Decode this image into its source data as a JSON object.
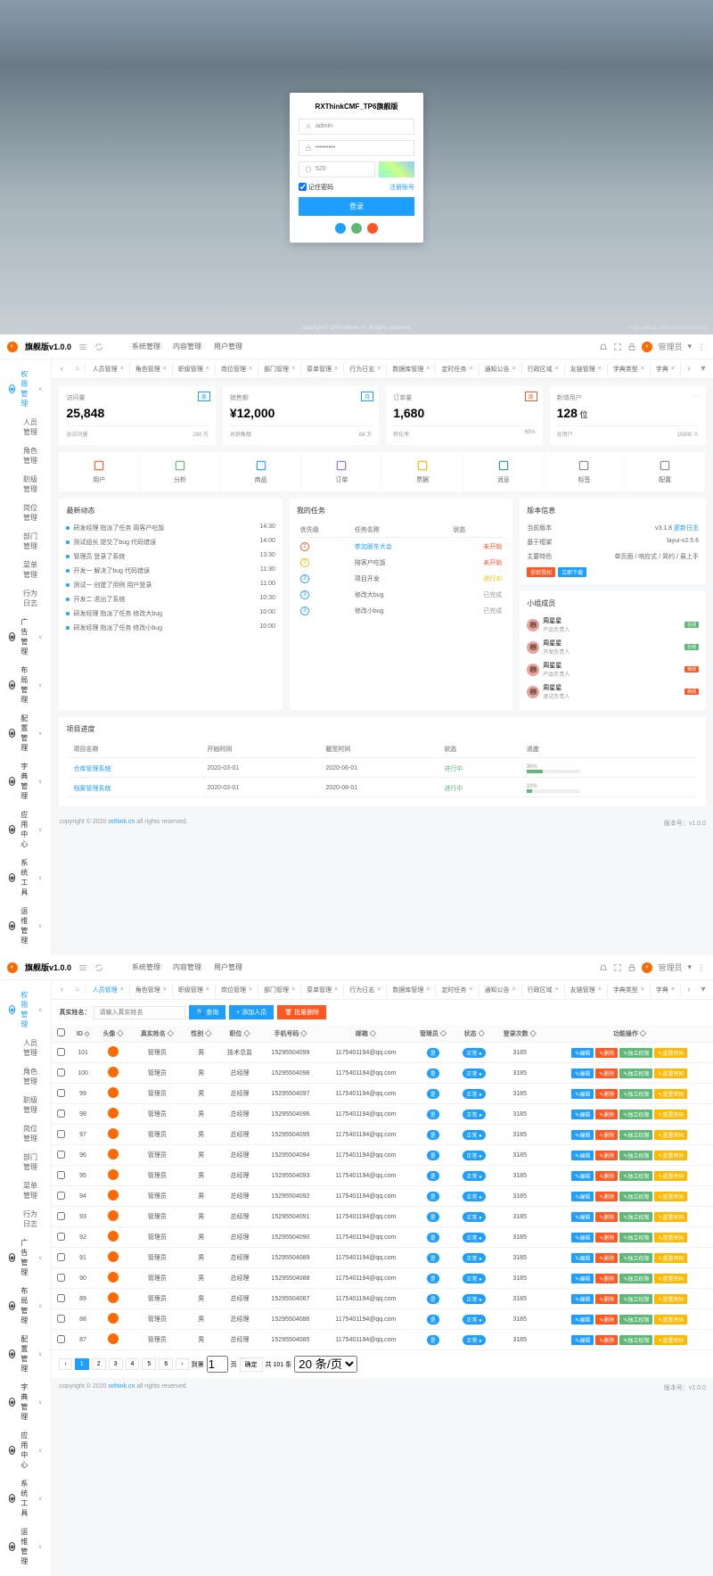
{
  "login": {
    "title": "RXThinkCMF_TP6旗舰版",
    "username": "admin",
    "password": "•••••••••",
    "captcha": "520",
    "remember": "记住密码",
    "register": "注册账号",
    "submit": "登录",
    "copyright": "copyright © 2020 rxthink.cn all rights reserved.",
    "watermark": "https://blog.csdn.net/zongzhiqing"
  },
  "topbar": {
    "title": "旗舰版v1.0.0",
    "menu": [
      "系统管理",
      "内容管理",
      "用户管理"
    ],
    "admin_label": "管理员"
  },
  "sidebar": {
    "groups": [
      {
        "icon": "◉",
        "label": "权限管理",
        "children": [
          "人员管理",
          "角色管理",
          "职级管理",
          "岗位管理",
          "部门管理",
          "菜单管理",
          "行为日志"
        ]
      },
      {
        "icon": "◉",
        "label": "广告管理"
      },
      {
        "icon": "◉",
        "label": "布局管理"
      },
      {
        "icon": "◉",
        "label": "配置管理"
      },
      {
        "icon": "◉",
        "label": "字典管理"
      },
      {
        "icon": "◉",
        "label": "应用中心"
      },
      {
        "icon": "◉",
        "label": "系统工具"
      },
      {
        "icon": "◉",
        "label": "运维管理"
      }
    ]
  },
  "tabs1": [
    "人员管理",
    "角色管理",
    "职级管理",
    "岗位管理",
    "部门管理",
    "菜单管理",
    "行为日志",
    "数据库管理",
    "定时任务",
    "通知公告",
    "行政区域",
    "友链管理",
    "字典类型",
    "字典"
  ],
  "cards": [
    {
      "title": "访问量",
      "value": "25,848",
      "foot_l": "总访问量",
      "foot_r": "280 万",
      "badge": "周",
      "badge_color": "#1E9FFF"
    },
    {
      "title": "销售额",
      "value": "¥12,000",
      "foot_l": "总销售额",
      "foot_r": "68 万",
      "badge": "月",
      "badge_color": "#1E9FFF"
    },
    {
      "title": "订单量",
      "value": "1,680",
      "foot_l": "转化率",
      "foot_r": "60%",
      "badge": "周",
      "badge_color": "#FF5722"
    },
    {
      "title": "新增用户",
      "value": "128",
      "unit": "位",
      "foot_l": "总用户",
      "foot_r": "10800 人"
    }
  ],
  "quick": [
    {
      "label": "用户",
      "color": "#FF5722"
    },
    {
      "label": "分析",
      "color": "#5FB878"
    },
    {
      "label": "商品",
      "color": "#1E9FFF"
    },
    {
      "label": "订单",
      "color": "#9370DB"
    },
    {
      "label": "票据",
      "color": "#FFB800"
    },
    {
      "label": "消息",
      "color": "#2F9688"
    },
    {
      "label": "标签",
      "color": "#888"
    },
    {
      "label": "配置",
      "color": "#888"
    }
  ],
  "news": {
    "title": "最新动态",
    "items": [
      {
        "t": "研发经理 指派了任务 周客户吃饭",
        "d": "14:30"
      },
      {
        "t": "测试组长 提交了bug 代码错误",
        "d": "14:00"
      },
      {
        "t": "管理员 登录了系统",
        "d": "13:30"
      },
      {
        "t": "开发一 解决了bug 代码错误",
        "d": "11:30"
      },
      {
        "t": "测试一 创建了用例 用户登录",
        "d": "11:00"
      },
      {
        "t": "开发二 退出了系统",
        "d": "10:30"
      },
      {
        "t": "研发经理 指派了任务 修改大bug",
        "d": "10:00"
      },
      {
        "t": "研发经理 指派了任务 修改小bug",
        "d": "10:00"
      }
    ]
  },
  "tasks": {
    "title": "我的任务",
    "cols": [
      "优先级",
      "任务名称",
      "状态"
    ],
    "rows": [
      {
        "n": "1",
        "c": "#FF5722",
        "name": "参加股东大会",
        "link": true,
        "status": "未开始",
        "sc": "#FF5722"
      },
      {
        "n": "2",
        "c": "#FFB800",
        "name": "陪客户吃饭",
        "status": "未开始",
        "sc": "#FF5722"
      },
      {
        "n": "3",
        "c": "#1E9FFF",
        "name": "项目开发",
        "status": "进行中",
        "sc": "#FFB800"
      },
      {
        "n": "3",
        "c": "#1E9FFF",
        "name": "修改大bug",
        "status": "已完成",
        "sc": "#999"
      },
      {
        "n": "3",
        "c": "#1E9FFF",
        "name": "修改小bug",
        "status": "已完成",
        "sc": "#999"
      }
    ]
  },
  "version": {
    "title": "版本信息",
    "rows": [
      {
        "k": "当前版本",
        "v": "v3.1.8",
        "link": "更新日志"
      },
      {
        "k": "基于框架",
        "v": "layui-v2.5.6"
      },
      {
        "k": "主要特色",
        "v": "单页面 / 响应式 / 简约 / 易上手"
      }
    ],
    "btn1": "获取授权",
    "btn2": "立即下载"
  },
  "team": {
    "title": "小组成员",
    "members": [
      {
        "name": "周星星",
        "role": "产品负责人",
        "badge": "在线",
        "bc": "#5FB878"
      },
      {
        "name": "周星星",
        "role": "开发负责人",
        "badge": "在线",
        "bc": "#5FB878"
      },
      {
        "name": "周星星",
        "role": "产品负责人",
        "badge": "离线",
        "bc": "#FF5722"
      },
      {
        "name": "周星星",
        "role": "测试负责人",
        "badge": "离线",
        "bc": "#FF5722"
      }
    ]
  },
  "projects": {
    "title": "项目进度",
    "cols": [
      "项目名称",
      "开始时间",
      "截至时间",
      "状态",
      "进度"
    ],
    "rows": [
      {
        "name": "仓库管理系统",
        "start": "2020-03-01",
        "end": "2020-06-01",
        "status": "进行中",
        "pct": 30
      },
      {
        "name": "档案管理系统",
        "start": "2020-03-01",
        "end": "2020-08-01",
        "status": "进行中",
        "pct": 10
      }
    ]
  },
  "footer": {
    "copy": "copyright © 2020",
    "link": "rxthink.cn",
    "rest": "all rights reserved.",
    "version": "版本号：v1.0.0"
  },
  "tabs2": [
    "人员管理",
    "角色管理",
    "职级管理",
    "岗位管理",
    "部门管理",
    "菜单管理",
    "行为日志",
    "数据库管理",
    "定时任务",
    "通知公告",
    "行政区域",
    "友链管理",
    "字典类型",
    "字典"
  ],
  "search": {
    "label": "真实姓名：",
    "placeholder": "请输入真实姓名",
    "btn_search": "查询",
    "btn_add": "添加人员",
    "btn_del": "批量删除"
  },
  "table": {
    "cols": [
      "",
      "ID",
      "头像",
      "真实姓名",
      "性别",
      "职位",
      "手机号码",
      "邮箱",
      "管理员",
      "状态",
      "登录次数",
      "功能操作"
    ],
    "ops": [
      "编辑",
      "删除",
      "独立权限",
      "重置密码"
    ],
    "op_colors": [
      "#1E9FFF",
      "#FF5722",
      "#5FB878",
      "#FFB800"
    ],
    "rows": [
      {
        "id": 101,
        "name": "管理员",
        "sex": "男",
        "pos": "技术总监",
        "phone": "15295504099",
        "email": "1175401194@qq.com",
        "login": 3185
      },
      {
        "id": 100,
        "name": "管理员",
        "sex": "男",
        "pos": "总经理",
        "phone": "15295504098",
        "email": "1175401194@qq.com",
        "login": 3185
      },
      {
        "id": 99,
        "name": "管理员",
        "sex": "男",
        "pos": "总经理",
        "phone": "15295504097",
        "email": "1175401194@qq.com",
        "login": 3185
      },
      {
        "id": 98,
        "name": "管理员",
        "sex": "男",
        "pos": "总经理",
        "phone": "15295504096",
        "email": "1175401194@qq.com",
        "login": 3185
      },
      {
        "id": 97,
        "name": "管理员",
        "sex": "男",
        "pos": "总经理",
        "phone": "15295504095",
        "email": "1175401194@qq.com",
        "login": 3185
      },
      {
        "id": 96,
        "name": "管理员",
        "sex": "男",
        "pos": "总经理",
        "phone": "15295504094",
        "email": "1175401194@qq.com",
        "login": 3185
      },
      {
        "id": 95,
        "name": "管理员",
        "sex": "男",
        "pos": "总经理",
        "phone": "15295504093",
        "email": "1175401194@qq.com",
        "login": 3185
      },
      {
        "id": 94,
        "name": "管理员",
        "sex": "男",
        "pos": "总经理",
        "phone": "15295504092",
        "email": "1175401194@qq.com",
        "login": 3185
      },
      {
        "id": 93,
        "name": "管理员",
        "sex": "男",
        "pos": "总经理",
        "phone": "15295504091",
        "email": "1175401194@qq.com",
        "login": 3185
      },
      {
        "id": 92,
        "name": "管理员",
        "sex": "男",
        "pos": "总经理",
        "phone": "15295504090",
        "email": "1175401194@qq.com",
        "login": 3185
      },
      {
        "id": 91,
        "name": "管理员",
        "sex": "男",
        "pos": "总经理",
        "phone": "15295504089",
        "email": "1175401194@qq.com",
        "login": 3185
      },
      {
        "id": 90,
        "name": "管理员",
        "sex": "男",
        "pos": "总经理",
        "phone": "15295504088",
        "email": "1175401194@qq.com",
        "login": 3185
      },
      {
        "id": 89,
        "name": "管理员",
        "sex": "男",
        "pos": "总经理",
        "phone": "15295504087",
        "email": "1175401194@qq.com",
        "login": 3185
      },
      {
        "id": 88,
        "name": "管理员",
        "sex": "男",
        "pos": "总经理",
        "phone": "15295504086",
        "email": "1175401194@qq.com",
        "login": 3185
      },
      {
        "id": 87,
        "name": "管理员",
        "sex": "男",
        "pos": "总经理",
        "phone": "15295504085",
        "email": "1175401194@qq.com",
        "login": 3185
      }
    ],
    "status_text": "正常",
    "admin_text": "是"
  },
  "pagination": {
    "pages": [
      "1",
      "2",
      "3",
      "4",
      "5",
      "6"
    ],
    "goto": "到第",
    "page_unit": "页",
    "confirm": "确定",
    "total": "共 101 条",
    "per": "20 条/页"
  }
}
